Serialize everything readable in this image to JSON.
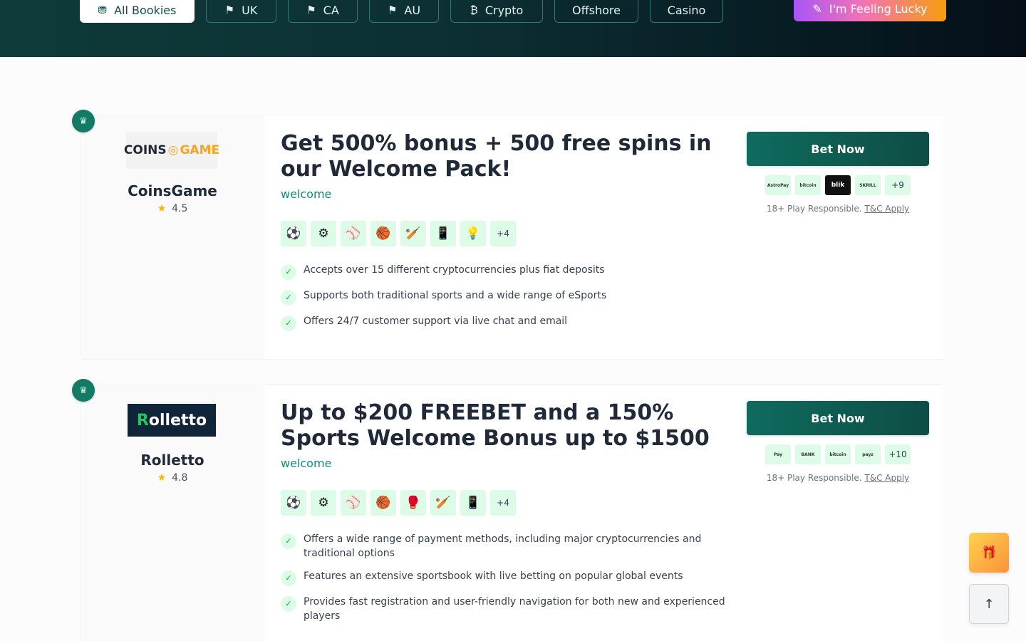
{
  "filters": [
    {
      "label": "All Bookies",
      "icon": "⛃"
    },
    {
      "label": "UK",
      "icon": "⚑"
    },
    {
      "label": "CA",
      "icon": "⚑"
    },
    {
      "label": "AU",
      "icon": "⚑"
    },
    {
      "label": "Crypto",
      "icon": "₿"
    },
    {
      "label": "Offshore",
      "icon": ""
    },
    {
      "label": "Casino",
      "icon": ""
    }
  ],
  "lucky": {
    "label": "I'm Feeling Lucky",
    "icon": "✎"
  },
  "bookies": [
    {
      "rank_icon": "♛",
      "logo_a": "COINS",
      "logo_b": "GAME",
      "name": "CoinsGame",
      "rating": "4.5",
      "headline": "Get 500% bonus + 500 free spins in our Welcome Pack!",
      "tag": "welcome",
      "sports": [
        "⚽",
        "⚙",
        "⚾",
        "🏀",
        "🏏",
        "📱",
        "💡"
      ],
      "sports_more": "+4",
      "features": [
        "Accepts over 15 different cryptocurrencies plus fiat deposits",
        "Supports both traditional sports and a wide range of eSports",
        "Offers 24/7 customer support via live chat and email"
      ],
      "bet_label": "Bet Now",
      "payments": [
        "AstroPay",
        "bitcoin",
        "blik",
        "SKRILL"
      ],
      "payments_more": "+9",
      "responsible": "18+ Play Responsible.",
      "tc": "T&C Apply"
    },
    {
      "rank_icon": "♛",
      "logo_a": "R",
      "logo_b": "olletto",
      "name": "Rolletto",
      "rating": "4.8",
      "headline": "Up to $200 FREEBET and a 150% Sports Welcome Bonus up to $1500",
      "tag": "welcome",
      "sports": [
        "⚽",
        "⚙",
        "⚾",
        "🏀",
        "🥊",
        "🏏",
        "📱"
      ],
      "sports_more": "+4",
      "features": [
        "Offers a wide range of payment methods, including major cryptocurrencies and traditional options",
        "Features an extensive sportsbook with live betting on popular global events",
        "Provides fast registration and user-friendly navigation for both new and experienced players"
      ],
      "bet_label": "Bet Now",
      "payments": [
        "Pay",
        "BANK",
        "bitcoin",
        "payz"
      ],
      "payments_more": "+10",
      "responsible": "18+ Play Responsible.",
      "tc": "T&C Apply"
    }
  ],
  "floating": {
    "gift_icon": "🎁",
    "up_icon": "↑"
  }
}
